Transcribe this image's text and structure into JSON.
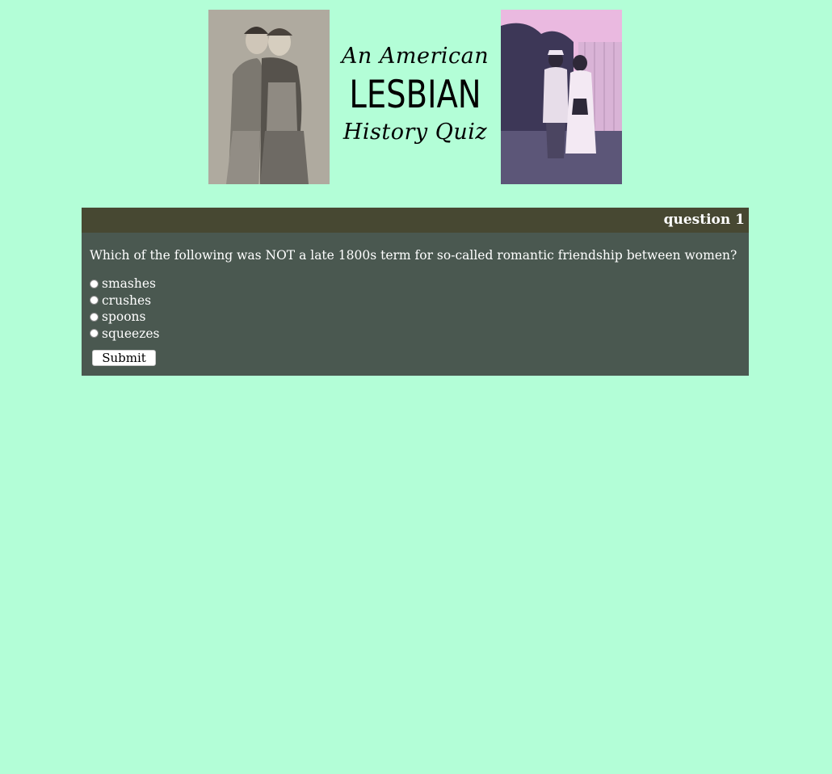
{
  "header": {
    "title_line1": "An American",
    "title_main": "LESBIAN",
    "title_line3": "History Quiz",
    "left_photo": "two women in 1800s dress photograph",
    "right_photo": "two women standing outdoors photograph"
  },
  "quiz": {
    "question_label": "question 1",
    "question_text": "Which of the following was NOT a late 1800s term for so-called romantic friendship between women?",
    "options": [
      "smashes",
      "crushes",
      "spoons",
      "squeezes"
    ],
    "submit_label": "Submit"
  },
  "colors": {
    "page_background": "#b3fed7",
    "panel_background": "#4a5850",
    "panel_header": "#474832",
    "text": "#ffffff"
  }
}
